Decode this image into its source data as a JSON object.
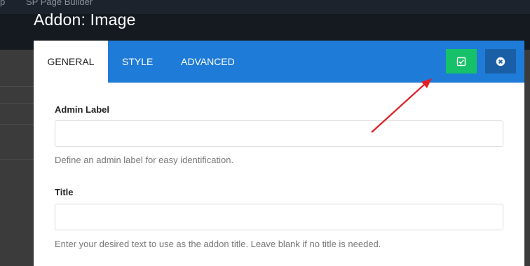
{
  "background": {
    "topbar_items": [
      "p",
      "SP Page Builder"
    ]
  },
  "modal": {
    "title": "Addon: Image",
    "tabs": [
      {
        "label": "GENERAL",
        "active": true
      },
      {
        "label": "STYLE",
        "active": false
      },
      {
        "label": "ADVANCED",
        "active": false
      }
    ],
    "buttons": {
      "apply_icon": "check-square-icon",
      "cancel_icon": "close-circle-icon"
    },
    "fields": [
      {
        "label": "Admin Label",
        "value": "",
        "help": "Define an admin label for easy identification."
      },
      {
        "label": "Title",
        "value": "",
        "help": "Enter your desired text to use as the addon title. Leave blank if no title is needed."
      }
    ]
  },
  "colors": {
    "tab_bar": "#1f7bd8",
    "apply_button": "#17c169",
    "cancel_button": "#1a5fa6",
    "annotation_arrow": "#e31e24"
  }
}
